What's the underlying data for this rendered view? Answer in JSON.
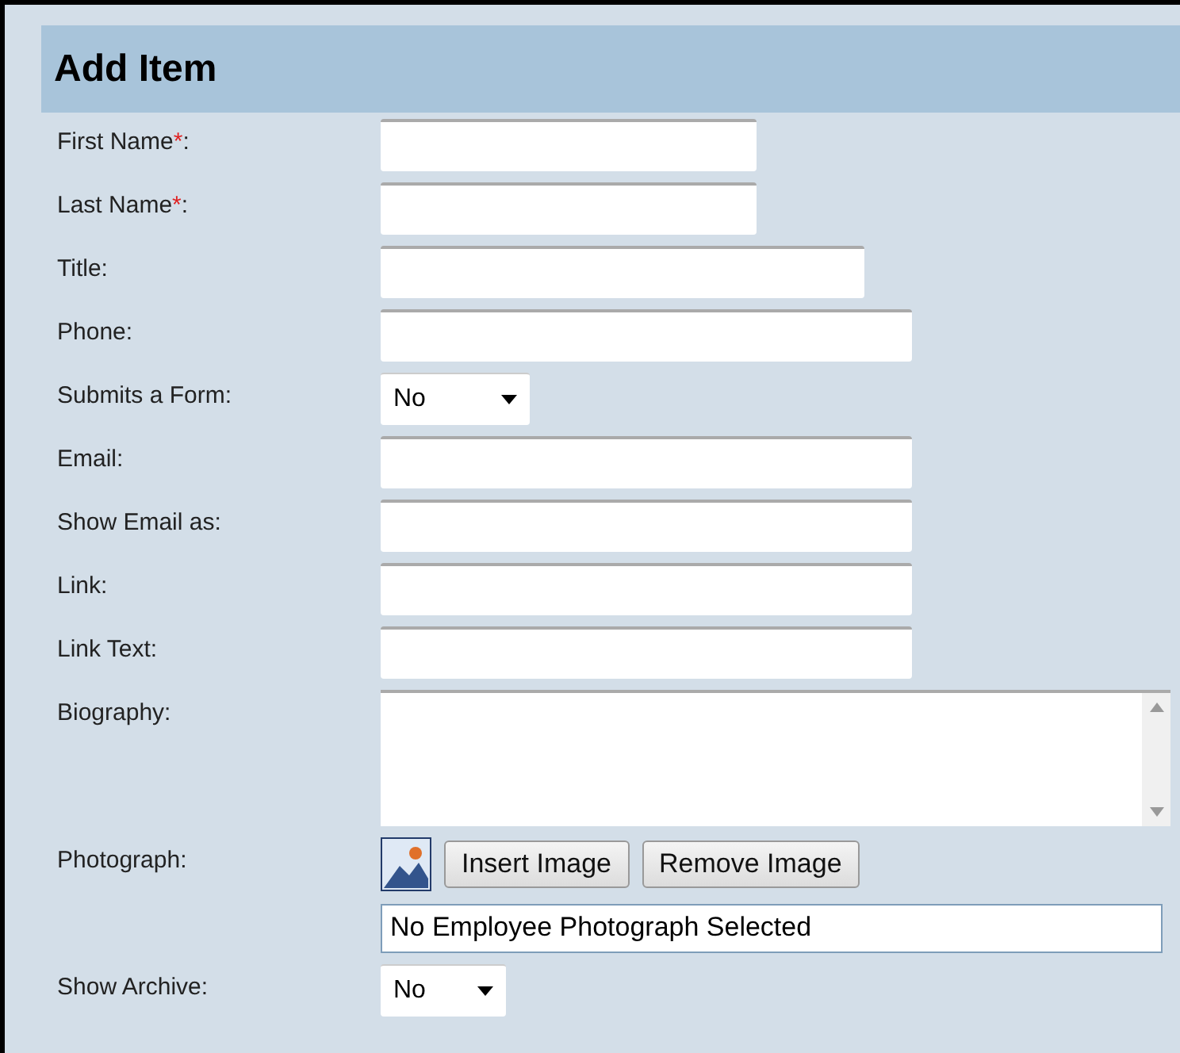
{
  "title": "Add Item",
  "fields": [
    {
      "kind": "text",
      "label": "First Name",
      "required_mark": "*",
      "label_end": ":"
    },
    {
      "kind": "text",
      "label": "Last Name",
      "required_mark": "*",
      "label_end": ":"
    },
    {
      "kind": "text",
      "label": "Title:"
    },
    {
      "kind": "text",
      "label": "Phone:"
    },
    {
      "kind": "select",
      "label": "Submits a Form:",
      "value": "No"
    },
    {
      "kind": "text",
      "label": "Email:"
    },
    {
      "kind": "text",
      "label": "Show Email as:"
    },
    {
      "kind": "text",
      "label": "Link:"
    },
    {
      "kind": "text",
      "label": "Link Text:"
    },
    {
      "kind": "textarea",
      "label": "Biography:"
    },
    {
      "kind": "photo",
      "label": "Photograph:",
      "buttons": [
        "Insert Image",
        "Remove Image"
      ],
      "value": "No Employee Photograph Selected"
    },
    {
      "kind": "select",
      "label": "Show Archive:",
      "value": "No"
    }
  ]
}
